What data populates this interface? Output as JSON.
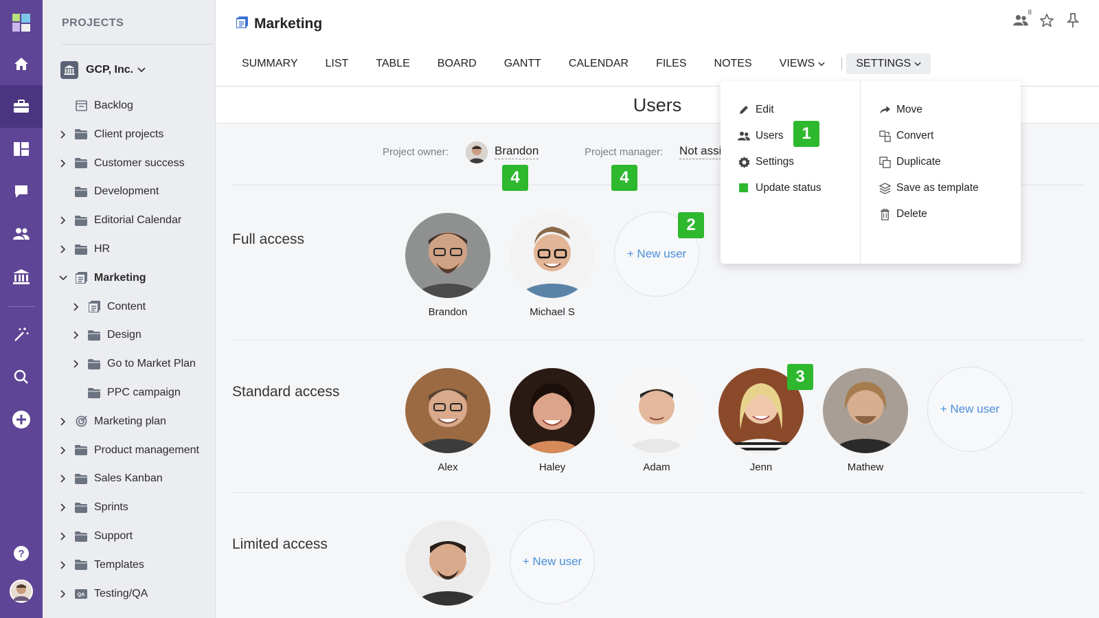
{
  "sidebar": {
    "title": "PROJECTS",
    "workspace": "GCP, Inc.",
    "items": [
      {
        "label": "Backlog",
        "icon": "backlog-icon",
        "has_chevron": false,
        "level": 0,
        "bold": false
      },
      {
        "label": "Client projects",
        "icon": "folder-icon",
        "has_chevron": true,
        "level": 0,
        "bold": false
      },
      {
        "label": "Customer success",
        "icon": "folder-icon",
        "has_chevron": true,
        "level": 0,
        "bold": false
      },
      {
        "label": "Development",
        "icon": "folder-icon",
        "has_chevron": false,
        "level": 0,
        "bold": false
      },
      {
        "label": "Editorial Calendar",
        "icon": "folder-icon",
        "has_chevron": true,
        "level": 0,
        "bold": false
      },
      {
        "label": "HR",
        "icon": "folder-icon",
        "has_chevron": true,
        "level": 0,
        "bold": false
      },
      {
        "label": "Marketing",
        "icon": "project-icon",
        "has_chevron": true,
        "expanded": true,
        "level": 0,
        "bold": true
      },
      {
        "label": "Content",
        "icon": "project-icon",
        "has_chevron": true,
        "level": 1,
        "bold": false
      },
      {
        "label": "Design",
        "icon": "folder-icon",
        "has_chevron": true,
        "level": 1,
        "bold": false
      },
      {
        "label": "Go to Market Plan",
        "icon": "folder-icon",
        "has_chevron": true,
        "level": 1,
        "bold": false
      },
      {
        "label": "PPC campaign",
        "icon": "folder-icon",
        "has_chevron": false,
        "level": 1,
        "bold": false
      },
      {
        "label": "Marketing plan",
        "icon": "target-icon",
        "has_chevron": true,
        "level": 0,
        "bold": false
      },
      {
        "label": "Product management",
        "icon": "folder-icon",
        "has_chevron": true,
        "level": 0,
        "bold": false
      },
      {
        "label": "Sales Kanban",
        "icon": "folder-icon",
        "has_chevron": true,
        "level": 0,
        "bold": false
      },
      {
        "label": "Sprints",
        "icon": "folder-icon",
        "has_chevron": true,
        "level": 0,
        "bold": false
      },
      {
        "label": "Support",
        "icon": "folder-icon",
        "has_chevron": true,
        "level": 0,
        "bold": false
      },
      {
        "label": "Templates",
        "icon": "folder-icon",
        "has_chevron": true,
        "level": 0,
        "bold": false
      },
      {
        "label": "Testing/QA",
        "icon": "qa-icon",
        "has_chevron": true,
        "level": 0,
        "bold": false
      }
    ]
  },
  "header": {
    "title": "Marketing",
    "team_count": "8",
    "tabs": [
      "SUMMARY",
      "LIST",
      "TABLE",
      "BOARD",
      "GANTT",
      "CALENDAR",
      "FILES",
      "NOTES",
      "VIEWS"
    ],
    "settings_tab": "SETTINGS"
  },
  "users_page": {
    "title": "Users",
    "owner_label": "Project owner:",
    "owner_value": "Brandon",
    "manager_label": "Project manager:",
    "manager_value": "Not assi",
    "new_user_label": "+ New user",
    "sections": [
      {
        "label": "Full access",
        "users": [
          "Brandon",
          "Michael S"
        ]
      },
      {
        "label": "Standard access",
        "users": [
          "Alex",
          "Haley",
          "Adam",
          "Jenn",
          "Mathew"
        ]
      },
      {
        "label": "Limited access",
        "users": [
          ""
        ]
      }
    ]
  },
  "settings_menu": {
    "left": [
      {
        "label": "Edit",
        "icon": "pencil-icon"
      },
      {
        "label": "Users",
        "icon": "users-icon"
      },
      {
        "label": "Settings",
        "icon": "gear-icon"
      },
      {
        "label": "Update status",
        "icon": "status-square-icon"
      }
    ],
    "right": [
      {
        "label": "Move",
        "icon": "move-arrow-icon"
      },
      {
        "label": "Convert",
        "icon": "convert-icon"
      },
      {
        "label": "Duplicate",
        "icon": "duplicate-icon"
      },
      {
        "label": "Save as template",
        "icon": "layers-icon"
      },
      {
        "label": "Delete",
        "icon": "trash-icon"
      }
    ]
  },
  "badges": [
    "1",
    "2",
    "3",
    "4",
    "4"
  ],
  "colors": {
    "rail": "#5f4596",
    "badge": "#2eb82e",
    "link": "#4a8fd8",
    "status": "#2eb82e"
  }
}
